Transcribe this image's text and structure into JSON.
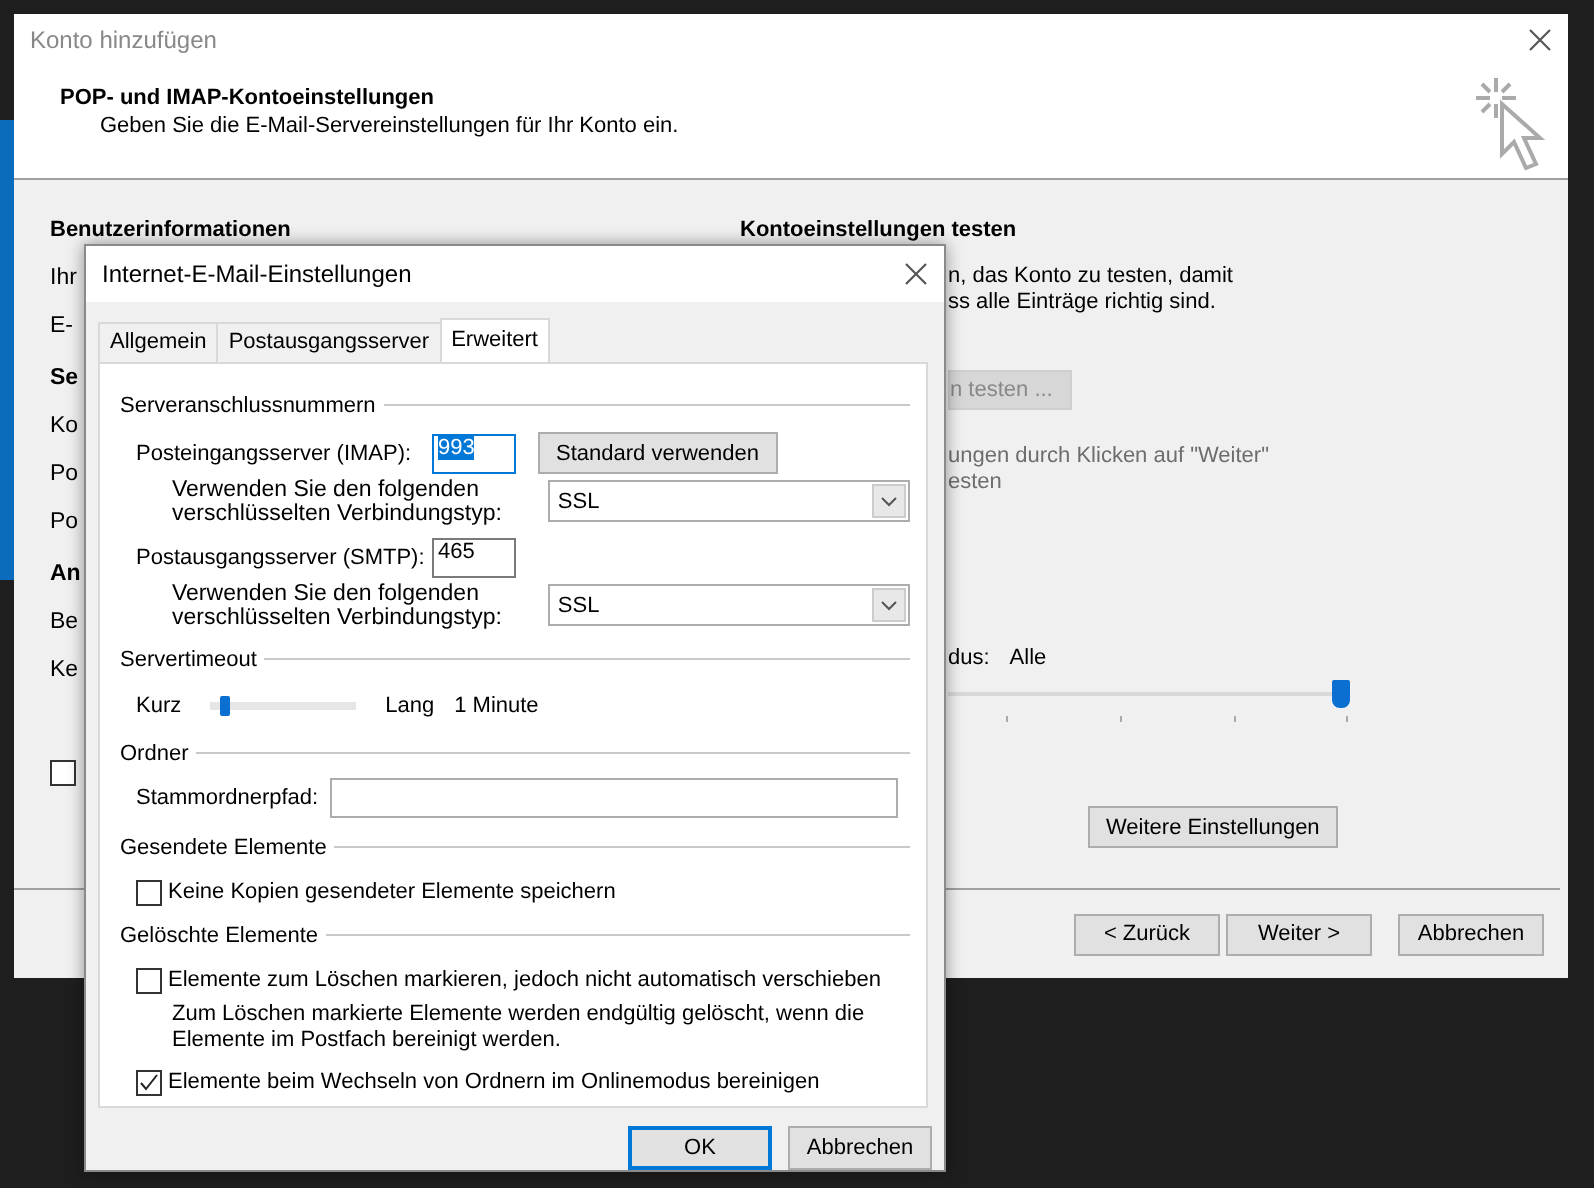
{
  "window": {
    "title": "Konto hinzufügen"
  },
  "header": {
    "title": "POP- und IMAP-Kontoeinstellungen",
    "subtitle": "Geben Sie die E-Mail-Servereinstellungen für Ihr Konto ein."
  },
  "left_section": {
    "title": "Benutzerinformationen",
    "items": [
      {
        "kind": "label",
        "text": "Ihr"
      },
      {
        "kind": "label",
        "text": "E-"
      },
      {
        "kind": "heading",
        "text": "Se"
      },
      {
        "kind": "label",
        "text": "Ko"
      },
      {
        "kind": "label",
        "text": "Po"
      },
      {
        "kind": "label",
        "text": "Po"
      },
      {
        "kind": "heading",
        "text": "An"
      },
      {
        "kind": "label",
        "text": "Be"
      },
      {
        "kind": "label",
        "text": "Ke"
      },
      {
        "kind": "checkbox",
        "checked": false
      }
    ]
  },
  "right_section": {
    "title": "Kontoeinstellungen testen",
    "description": [
      "n, das Konto zu testen, damit",
      "ss alle Einträge richtig sind."
    ],
    "test_button": {
      "label": "n testen ...",
      "disabled": true
    },
    "note": [
      "ungen durch Klicken auf \"Weiter\"",
      "esten"
    ],
    "mode_label": "dus:",
    "mode_value": "Alle",
    "mode_slider": {
      "level": 1
    },
    "more_button": "Weitere Einstellungen"
  },
  "footer_buttons": [
    "< Zurück",
    "Weiter >",
    "Abbrechen"
  ],
  "dialog": {
    "title": "Internet-E-Mail-Einstellungen",
    "tabs": [
      {
        "label": "Allgemein",
        "selected": false
      },
      {
        "label": "Postausgangsserver",
        "selected": false
      },
      {
        "label": "Erweitert",
        "selected": true
      }
    ],
    "groups": [
      {
        "title": "Serveranschlussnummern",
        "rows": [
          {
            "kind": "port",
            "label": "Posteingangsserver (IMAP):",
            "value": "993",
            "highlighted": true,
            "button": "Standard verwenden"
          },
          {
            "kind": "select",
            "label": "Verwenden Sie den folgenden verschlüsselten Verbindungstyp:",
            "value": "SSL"
          },
          {
            "kind": "port",
            "label": "Postausgangsserver (SMTP):",
            "value": "465",
            "highlighted": false
          },
          {
            "kind": "select",
            "label": "Verwenden Sie den folgenden verschlüsselten Verbindungstyp:",
            "value": "SSL"
          }
        ]
      },
      {
        "title": "Servertimeout",
        "rows": [
          {
            "kind": "slider",
            "min_label": "Kurz",
            "max_label": "Lang",
            "level": 0.1,
            "reading": "1 Minute"
          }
        ]
      },
      {
        "title": "Ordner",
        "rows": [
          {
            "kind": "field",
            "label": "Stammordnerpfad:"
          }
        ]
      },
      {
        "title": "Gesendete Elemente",
        "rows": [
          {
            "kind": "checkbox",
            "label": "Keine Kopien gesendeter Elemente speichern",
            "checked": false
          }
        ]
      },
      {
        "title": "Gelöschte Elemente",
        "rows": [
          {
            "kind": "checkbox",
            "label": "Elemente zum Löschen markieren, jedoch nicht automatisch verschieben",
            "checked": false
          },
          {
            "kind": "note",
            "text": "Zum Löschen markierte Elemente werden endgültig gelöscht, wenn die Elemente im Postfach bereinigt werden."
          },
          {
            "kind": "checkbox",
            "label": "Elemente beim Wechseln von Ordnern im Onlinemodus bereinigen",
            "checked": true
          }
        ]
      }
    ],
    "buttons": [
      {
        "label": "OK",
        "default": true
      },
      {
        "label": "Abbrechen",
        "default": false
      }
    ]
  }
}
